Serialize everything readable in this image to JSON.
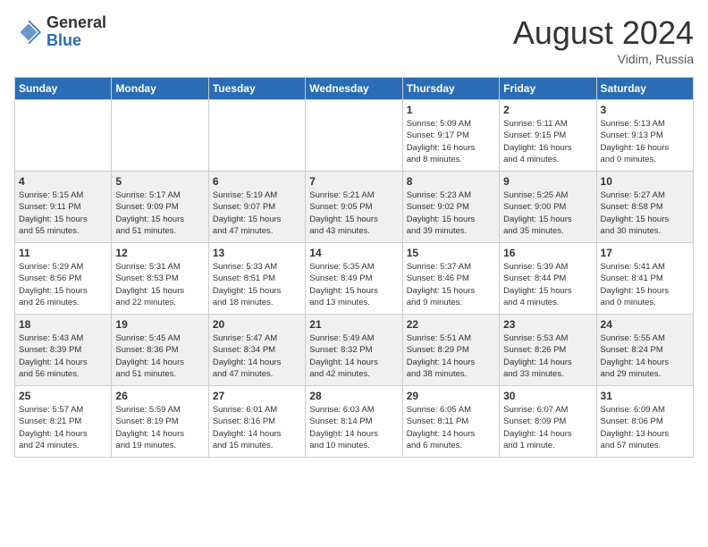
{
  "header": {
    "logo": {
      "general": "General",
      "blue": "Blue"
    },
    "month_year": "August 2024",
    "location": "Vidim, Russia"
  },
  "days_of_week": [
    "Sunday",
    "Monday",
    "Tuesday",
    "Wednesday",
    "Thursday",
    "Friday",
    "Saturday"
  ],
  "weeks": [
    [
      {
        "day": "",
        "info": ""
      },
      {
        "day": "",
        "info": ""
      },
      {
        "day": "",
        "info": ""
      },
      {
        "day": "",
        "info": ""
      },
      {
        "day": "1",
        "info": "Sunrise: 5:09 AM\nSunset: 9:17 PM\nDaylight: 16 hours\nand 8 minutes."
      },
      {
        "day": "2",
        "info": "Sunrise: 5:11 AM\nSunset: 9:15 PM\nDaylight: 16 hours\nand 4 minutes."
      },
      {
        "day": "3",
        "info": "Sunrise: 5:13 AM\nSunset: 9:13 PM\nDaylight: 16 hours\nand 0 minutes."
      }
    ],
    [
      {
        "day": "4",
        "info": "Sunrise: 5:15 AM\nSunset: 9:11 PM\nDaylight: 15 hours\nand 55 minutes."
      },
      {
        "day": "5",
        "info": "Sunrise: 5:17 AM\nSunset: 9:09 PM\nDaylight: 15 hours\nand 51 minutes."
      },
      {
        "day": "6",
        "info": "Sunrise: 5:19 AM\nSunset: 9:07 PM\nDaylight: 15 hours\nand 47 minutes."
      },
      {
        "day": "7",
        "info": "Sunrise: 5:21 AM\nSunset: 9:05 PM\nDaylight: 15 hours\nand 43 minutes."
      },
      {
        "day": "8",
        "info": "Sunrise: 5:23 AM\nSunset: 9:02 PM\nDaylight: 15 hours\nand 39 minutes."
      },
      {
        "day": "9",
        "info": "Sunrise: 5:25 AM\nSunset: 9:00 PM\nDaylight: 15 hours\nand 35 minutes."
      },
      {
        "day": "10",
        "info": "Sunrise: 5:27 AM\nSunset: 8:58 PM\nDaylight: 15 hours\nand 30 minutes."
      }
    ],
    [
      {
        "day": "11",
        "info": "Sunrise: 5:29 AM\nSunset: 8:56 PM\nDaylight: 15 hours\nand 26 minutes."
      },
      {
        "day": "12",
        "info": "Sunrise: 5:31 AM\nSunset: 8:53 PM\nDaylight: 15 hours\nand 22 minutes."
      },
      {
        "day": "13",
        "info": "Sunrise: 5:33 AM\nSunset: 8:51 PM\nDaylight: 15 hours\nand 18 minutes."
      },
      {
        "day": "14",
        "info": "Sunrise: 5:35 AM\nSunset: 8:49 PM\nDaylight: 15 hours\nand 13 minutes."
      },
      {
        "day": "15",
        "info": "Sunrise: 5:37 AM\nSunset: 8:46 PM\nDaylight: 15 hours\nand 9 minutes."
      },
      {
        "day": "16",
        "info": "Sunrise: 5:39 AM\nSunset: 8:44 PM\nDaylight: 15 hours\nand 4 minutes."
      },
      {
        "day": "17",
        "info": "Sunrise: 5:41 AM\nSunset: 8:41 PM\nDaylight: 15 hours\nand 0 minutes."
      }
    ],
    [
      {
        "day": "18",
        "info": "Sunrise: 5:43 AM\nSunset: 8:39 PM\nDaylight: 14 hours\nand 56 minutes."
      },
      {
        "day": "19",
        "info": "Sunrise: 5:45 AM\nSunset: 8:36 PM\nDaylight: 14 hours\nand 51 minutes."
      },
      {
        "day": "20",
        "info": "Sunrise: 5:47 AM\nSunset: 8:34 PM\nDaylight: 14 hours\nand 47 minutes."
      },
      {
        "day": "21",
        "info": "Sunrise: 5:49 AM\nSunset: 8:32 PM\nDaylight: 14 hours\nand 42 minutes."
      },
      {
        "day": "22",
        "info": "Sunrise: 5:51 AM\nSunset: 8:29 PM\nDaylight: 14 hours\nand 38 minutes."
      },
      {
        "day": "23",
        "info": "Sunrise: 5:53 AM\nSunset: 8:26 PM\nDaylight: 14 hours\nand 33 minutes."
      },
      {
        "day": "24",
        "info": "Sunrise: 5:55 AM\nSunset: 8:24 PM\nDaylight: 14 hours\nand 29 minutes."
      }
    ],
    [
      {
        "day": "25",
        "info": "Sunrise: 5:57 AM\nSunset: 8:21 PM\nDaylight: 14 hours\nand 24 minutes."
      },
      {
        "day": "26",
        "info": "Sunrise: 5:59 AM\nSunset: 8:19 PM\nDaylight: 14 hours\nand 19 minutes."
      },
      {
        "day": "27",
        "info": "Sunrise: 6:01 AM\nSunset: 8:16 PM\nDaylight: 14 hours\nand 15 minutes."
      },
      {
        "day": "28",
        "info": "Sunrise: 6:03 AM\nSunset: 8:14 PM\nDaylight: 14 hours\nand 10 minutes."
      },
      {
        "day": "29",
        "info": "Sunrise: 6:05 AM\nSunset: 8:11 PM\nDaylight: 14 hours\nand 6 minutes."
      },
      {
        "day": "30",
        "info": "Sunrise: 6:07 AM\nSunset: 8:09 PM\nDaylight: 14 hours\nand 1 minute."
      },
      {
        "day": "31",
        "info": "Sunrise: 6:09 AM\nSunset: 8:06 PM\nDaylight: 13 hours\nand 57 minutes."
      }
    ]
  ]
}
